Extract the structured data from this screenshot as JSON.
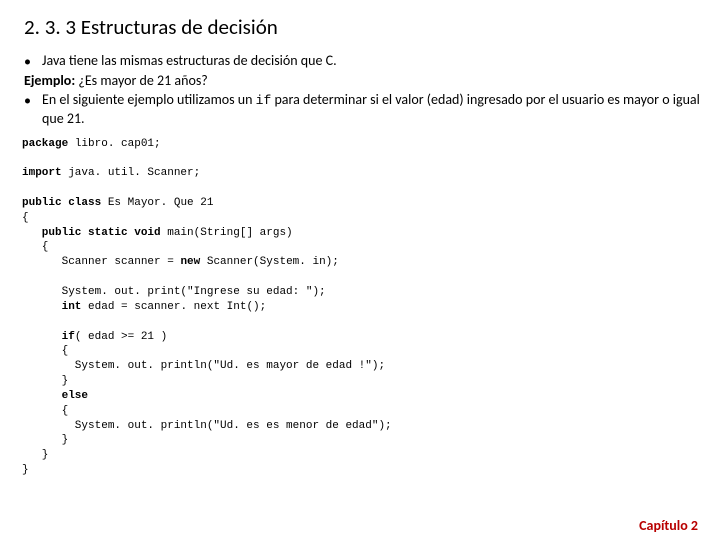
{
  "title": "2. 3. 3 Estructuras de decisión",
  "bullets": {
    "b1": "Java tiene las mismas estructuras de decisión que C.",
    "ej_label": "Ejemplo:",
    "ej_text": " ¿Es mayor de 21 años?",
    "b2a": "En el siguiente ejemplo utilizamos un ",
    "b2_code": "if",
    "b2b": " para determinar si el valor (edad) ingresado por el usuario es mayor o igual que 21."
  },
  "code": {
    "l01a": "package",
    "l01b": " libro. cap01;",
    "l02a": "import",
    "l02b": " java. util. Scanner;",
    "l03a": "public class ",
    "l03b": "Es Mayor. Que 21",
    "l04": "{",
    "l05a": "   public static void ",
    "l05b": "main(String[] args)",
    "l06": "   {",
    "l07a": "      Scanner scanner = ",
    "l07b": "new",
    "l07c": " Scanner(System. in);",
    "l08": "",
    "l09": "      System. out. print(\"Ingrese su edad: \");",
    "l10a": "      int",
    "l10b": " edad = scanner. next Int();",
    "l11": "",
    "l12a": "      if",
    "l12b": "( edad >= 21 )",
    "l13": "      {",
    "l14": "        System. out. println(\"Ud. es mayor de edad !\");",
    "l15": "      }",
    "l16a": "      else",
    "l16b": "",
    "l17": "      {",
    "l18": "        System. out. println(\"Ud. es es menor de edad\");",
    "l19": "      }",
    "l20": "   }",
    "l21": "}"
  },
  "footer": "Capítulo 2"
}
